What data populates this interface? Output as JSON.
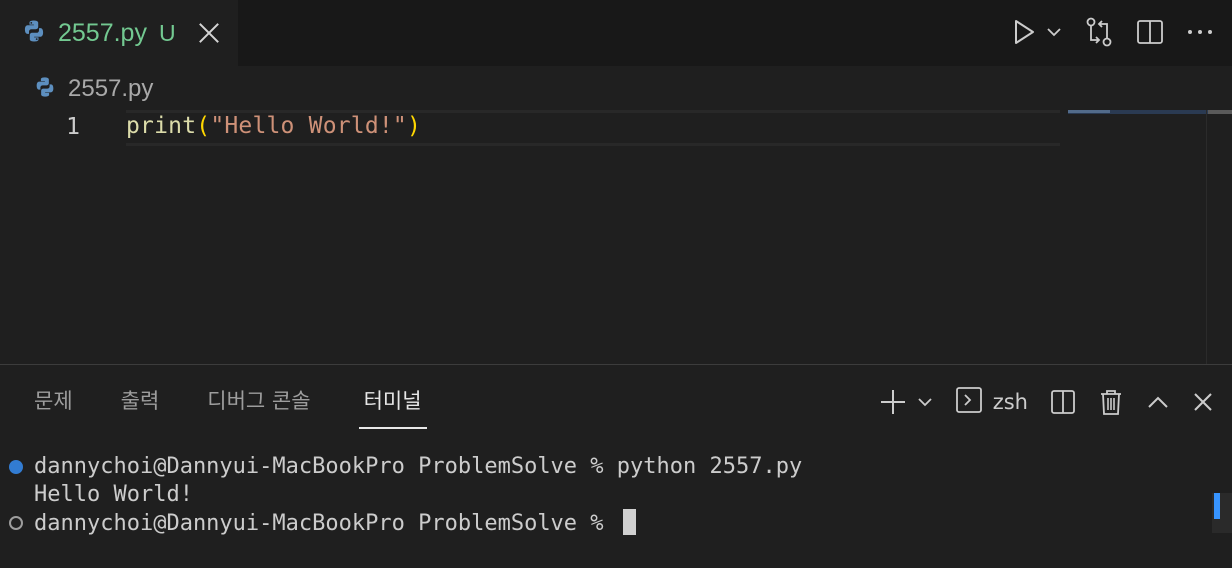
{
  "tab": {
    "filename": "2557.py",
    "status": "U"
  },
  "breadcrumb": {
    "file": "2557.py"
  },
  "editor": {
    "line_number": "1",
    "code": {
      "fn": "print",
      "open": "(",
      "string": "\"Hello World!\"",
      "close": ")"
    }
  },
  "panel": {
    "tabs": [
      {
        "label": "문제"
      },
      {
        "label": "출력"
      },
      {
        "label": "디버그 콘솔"
      },
      {
        "label": "터미널"
      }
    ],
    "shell": "zsh"
  },
  "terminal": {
    "lines": [
      "dannychoi@Dannyui-MacBookPro ProblemSolve % python 2557.py",
      "Hello World!",
      "dannychoi@Dannyui-MacBookPro ProblemSolve % "
    ]
  },
  "colors": {
    "accent": "#3794ff",
    "modified": "#73c991",
    "string": "#ce9178",
    "function": "#dcdcaa"
  },
  "icons": [
    "python-icon",
    "run-icon",
    "chevron-down-icon",
    "compare-changes-icon",
    "split-editor-icon",
    "more-icon",
    "plus-icon",
    "terminal-icon",
    "split-terminal-icon",
    "trash-icon",
    "chevron-up-icon",
    "close-icon"
  ]
}
